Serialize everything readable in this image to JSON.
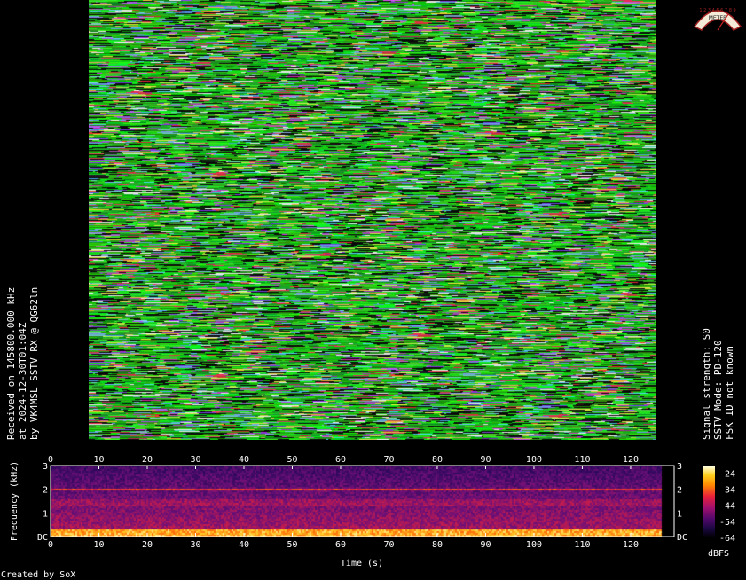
{
  "caption_left": {
    "line1": "Received on 145800.000 kHz",
    "line2": "at 2024-12-30T01:04Z",
    "line3": "by VK4MSL SSTV RX @ QG62ln"
  },
  "caption_right": {
    "line1": "Signal strength: S0",
    "line2": "SSTV Mode: PD-120",
    "line3": "FSK ID not known"
  },
  "spectrogram": {
    "x_ticks": [
      "0",
      "10",
      "20",
      "30",
      "40",
      "50",
      "60",
      "70",
      "80",
      "90",
      "100",
      "110",
      "120"
    ],
    "x_tick_values": [
      0,
      10,
      20,
      30,
      40,
      50,
      60,
      70,
      80,
      90,
      100,
      110,
      120
    ],
    "x_max": 129,
    "y_ticks_left": [
      "DC",
      "1",
      "2",
      "3"
    ],
    "y_ticks_right": [
      "DC",
      "1",
      "2",
      "3"
    ],
    "y_tick_values": [
      0,
      1,
      2,
      3
    ],
    "y_max": 3,
    "xlabel": "Time (s)",
    "ylabel": "Frequency (kHz)"
  },
  "colorbar": {
    "ticks": [
      "-24",
      "-34",
      "-44",
      "-54",
      "-64"
    ],
    "tick_values": [
      -24,
      -34,
      -44,
      -54,
      -64
    ],
    "range": [
      -64,
      -20
    ],
    "label": "dBFS"
  },
  "footer": {
    "created_by": "Created by SoX"
  },
  "logo": {
    "scale": "1 2 3 4 5 6 7 8 9",
    "text": "METER"
  }
}
